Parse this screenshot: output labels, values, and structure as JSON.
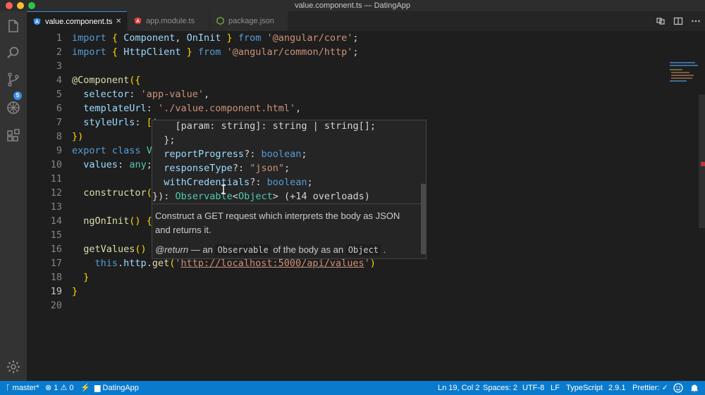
{
  "window": {
    "title": "value.component.ts — DatingApp"
  },
  "activity_bar": {
    "source_control_badge": "5"
  },
  "tabs": [
    {
      "label": "value.component.ts",
      "icon": "angular-ts-icon",
      "close": "✕"
    },
    {
      "label": "app.module.ts",
      "icon": "angular-icon"
    },
    {
      "label": "package.json",
      "icon": "nodejs-icon"
    }
  ],
  "editor": {
    "line_numbers": [
      "1",
      "2",
      "3",
      "4",
      "5",
      "6",
      "7",
      "8",
      "9",
      "10",
      "11",
      "12",
      "13",
      "14",
      "15",
      "16",
      "17",
      "18",
      "19",
      "20"
    ],
    "current_line": "19",
    "lines": [
      [
        [
          "kw",
          "import"
        ],
        [
          "pun",
          " "
        ],
        [
          "br",
          "{"
        ],
        [
          "pun",
          " "
        ],
        [
          "prop",
          "Component"
        ],
        [
          "pun",
          ", "
        ],
        [
          "prop",
          "OnInit"
        ],
        [
          "pun",
          " "
        ],
        [
          "br",
          "}"
        ],
        [
          "pun",
          " "
        ],
        [
          "kw",
          "from"
        ],
        [
          "pun",
          " "
        ],
        [
          "str",
          "'@angular/core'"
        ],
        [
          "pun",
          ";"
        ]
      ],
      [
        [
          "kw",
          "import"
        ],
        [
          "pun",
          " "
        ],
        [
          "br",
          "{"
        ],
        [
          "pun",
          " "
        ],
        [
          "prop",
          "HttpClient"
        ],
        [
          "pun",
          " "
        ],
        [
          "br",
          "}"
        ],
        [
          "pun",
          " "
        ],
        [
          "kw",
          "from"
        ],
        [
          "pun",
          " "
        ],
        [
          "str",
          "'@angular/common/http'"
        ],
        [
          "pun",
          ";"
        ]
      ],
      [],
      [
        [
          "fn",
          "@Component"
        ],
        [
          "br",
          "({"
        ]
      ],
      [
        [
          "pun",
          "  "
        ],
        [
          "prop",
          "selector"
        ],
        [
          "pun",
          ": "
        ],
        [
          "str",
          "'app-value'"
        ],
        [
          "pun",
          ","
        ]
      ],
      [
        [
          "pun",
          "  "
        ],
        [
          "prop",
          "templateUrl"
        ],
        [
          "pun",
          ": "
        ],
        [
          "str",
          "'./value.component.html'"
        ],
        [
          "pun",
          ","
        ]
      ],
      [
        [
          "pun",
          "  "
        ],
        [
          "prop",
          "styleUrls"
        ],
        [
          "pun",
          ": "
        ],
        [
          "br",
          "["
        ],
        [
          "str",
          "'"
        ]
      ],
      [
        [
          "br",
          "})"
        ]
      ],
      [
        [
          "kw",
          "export"
        ],
        [
          "pun",
          " "
        ],
        [
          "kw",
          "class"
        ],
        [
          "pun",
          " "
        ],
        [
          "cls",
          "V"
        ]
      ],
      [
        [
          "pun",
          "  "
        ],
        [
          "prop",
          "values"
        ],
        [
          "pun",
          ": "
        ],
        [
          "cls",
          "any"
        ],
        [
          "pun",
          ";"
        ]
      ],
      [],
      [
        [
          "pun",
          "  "
        ],
        [
          "fn",
          "constructor"
        ],
        [
          "br",
          "("
        ]
      ],
      [],
      [
        [
          "pun",
          "  "
        ],
        [
          "fn",
          "ngOnInit"
        ],
        [
          "br",
          "()"
        ],
        [
          "pun",
          " "
        ],
        [
          "br",
          "{"
        ]
      ],
      [],
      [
        [
          "pun",
          "  "
        ],
        [
          "fn",
          "getValues"
        ],
        [
          "br",
          "()"
        ]
      ],
      [
        [
          "pun",
          "    "
        ],
        [
          "kw",
          "this"
        ],
        [
          "pun",
          "."
        ],
        [
          "prop",
          "http"
        ],
        [
          "pun",
          "."
        ],
        [
          "fn",
          "get"
        ],
        [
          "br",
          "("
        ],
        [
          "str",
          "'"
        ],
        [
          "url",
          "http://localhost:5000/api/values"
        ],
        [
          "str",
          "'"
        ],
        [
          "br",
          ")"
        ]
      ],
      [
        [
          "pun",
          "  "
        ],
        [
          "br",
          "}"
        ]
      ],
      [
        [
          "br",
          "}"
        ]
      ],
      []
    ]
  },
  "hover": {
    "signature": [
      [
        [
          "pun",
          "    [param: string]: string | string[];"
        ]
      ],
      [
        [
          "pun",
          "  };"
        ]
      ],
      [
        [
          "pun",
          "  "
        ],
        [
          "prop",
          "reportProgress"
        ],
        [
          "pun",
          "?: "
        ],
        [
          "kw",
          "boolean"
        ],
        [
          "pun",
          ";"
        ]
      ],
      [
        [
          "pun",
          "  "
        ],
        [
          "prop",
          "responseType"
        ],
        [
          "pun",
          "?: "
        ],
        [
          "str",
          "\"json\""
        ],
        [
          "pun",
          ";"
        ]
      ],
      [
        [
          "pun",
          "  "
        ],
        [
          "prop",
          "withCredentials"
        ],
        [
          "pun",
          "?: "
        ],
        [
          "kw",
          "boolean"
        ],
        [
          "pun",
          ";"
        ]
      ],
      [
        [
          "pun",
          "}): "
        ],
        [
          "cls",
          "Observable"
        ],
        [
          "pun",
          "<"
        ],
        [
          "cls",
          "Object"
        ],
        [
          "pun",
          "> (+14 overloads)"
        ]
      ]
    ],
    "doc_line1": "Construct a GET request which interprets the body as JSON",
    "doc_line2": "and returns it.",
    "return_tag": "@return",
    "return_dash": " — an ",
    "return_code1": "Observable",
    "return_mid": " of the body as an ",
    "return_code2": "Object",
    "return_end": " ."
  },
  "status": {
    "branch": "master*",
    "errors": "1",
    "warnings": "0",
    "folder": "DatingApp",
    "position": "Ln 19, Col 2",
    "spaces": "Spaces: 2",
    "encoding": "UTF-8",
    "eol": "LF",
    "language": "TypeScript",
    "version": "2.9.1",
    "prettier": "Prettier: ✓"
  },
  "colors": {
    "accent": "#0a7acc",
    "editor_bg": "#1e1e1e",
    "badge": "#3a8ee6"
  }
}
